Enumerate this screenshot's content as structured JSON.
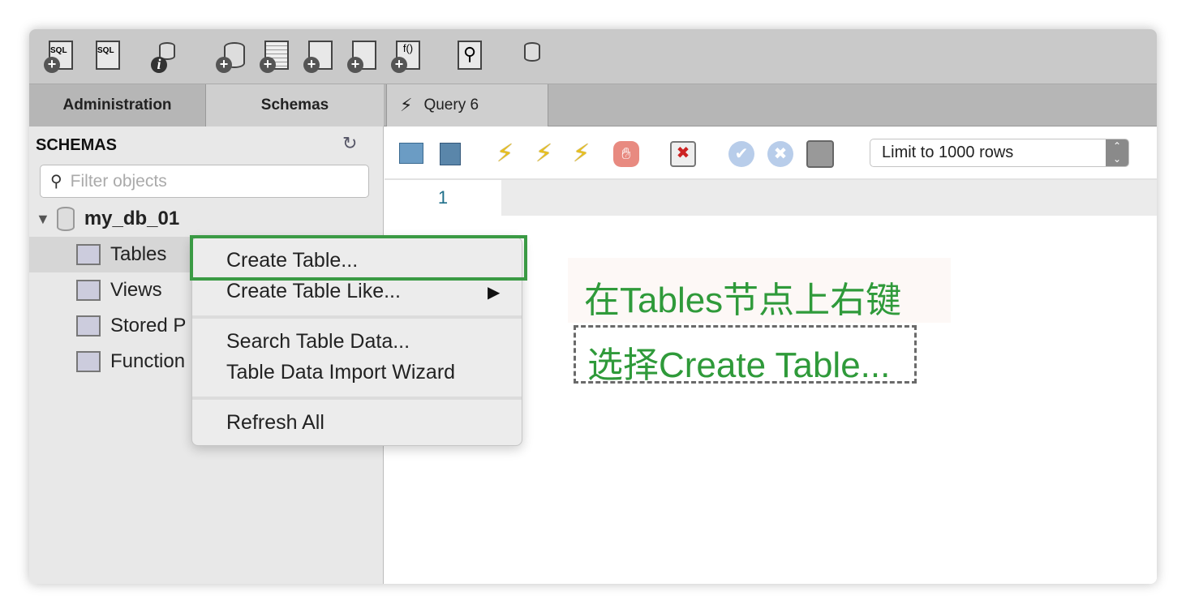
{
  "toolbar": {
    "icons": [
      "new-sql-tab-icon",
      "open-sql-file-icon",
      "schema-inspector-icon",
      "create-schema-icon",
      "create-table-icon",
      "create-view-icon",
      "create-procedure-icon",
      "create-function-icon",
      "search-table-data-icon",
      "reconnect-icon"
    ],
    "sql_label": "SQL",
    "func_label": "f()"
  },
  "tabs": {
    "administration": "Administration",
    "schemas": "Schemas",
    "query": "Query 6"
  },
  "sidebar": {
    "header": "SCHEMAS",
    "filter_placeholder": "Filter objects",
    "schema": "my_db_01",
    "items": [
      {
        "label": "Tables"
      },
      {
        "label": "Views"
      },
      {
        "label": "Stored P"
      },
      {
        "label": "Function"
      }
    ]
  },
  "query_toolbar": {
    "limit_select": "Limit to 1000 rows",
    "icons": [
      "open-file-icon",
      "save-icon",
      "execute-icon",
      "execute-current-icon",
      "explain-icon",
      "stop-icon",
      "toggle-continue-on-error-icon",
      "commit-icon",
      "rollback-icon",
      "autocommit-icon"
    ]
  },
  "editor": {
    "line_number": "1"
  },
  "context_menu": {
    "items": [
      "Create Table...",
      "Create Table Like...",
      "Search Table Data...",
      "Table Data Import Wizard",
      "Refresh All"
    ]
  },
  "annotation": {
    "line1": "在Tables节点上右键",
    "line2": "选择Create Table...",
    "color": "#2f9a3a"
  }
}
